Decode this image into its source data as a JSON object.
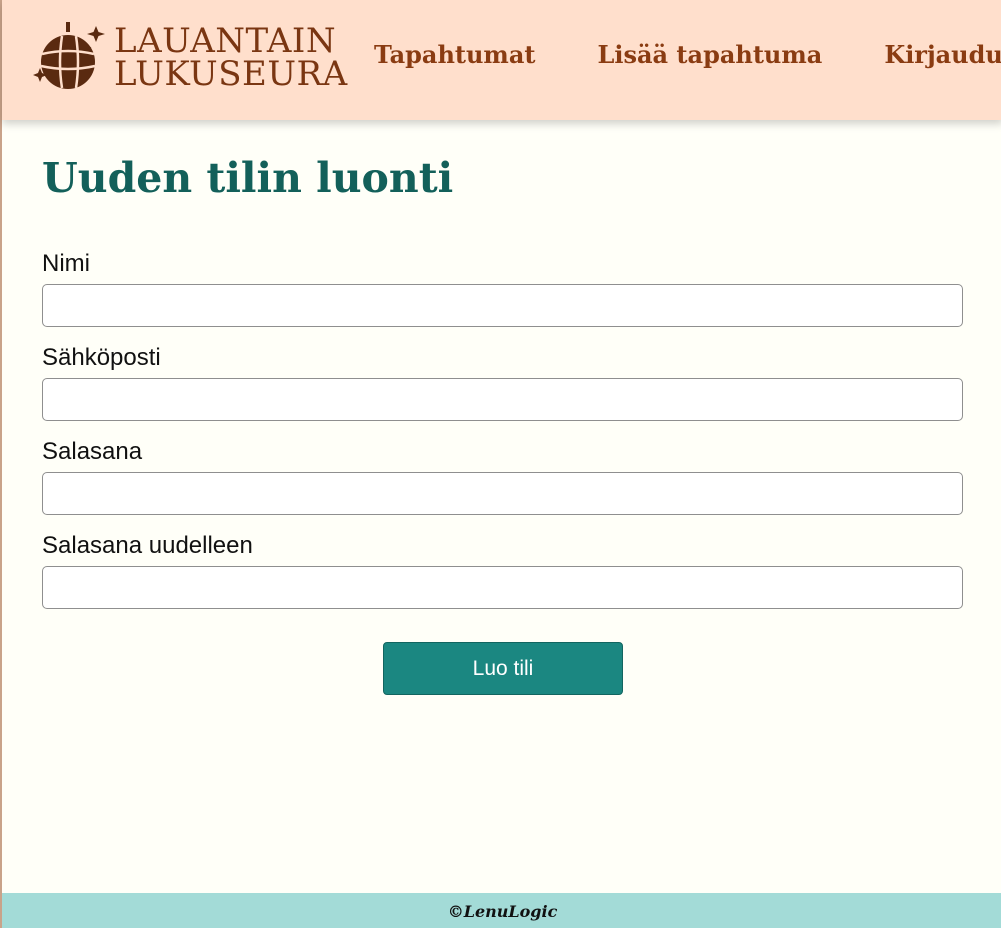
{
  "brand": {
    "line1": "LAUANTAIN",
    "line2": "LUKUSEURA",
    "icon": "disco-ball-sparkles-icon",
    "color": "#7a3612"
  },
  "nav": {
    "items": [
      {
        "label": "Tapahtumat"
      },
      {
        "label": "Lisää tapahtuma"
      },
      {
        "label": "Kirjaudu"
      }
    ]
  },
  "page": {
    "title": "Uuden tilin luonti"
  },
  "form": {
    "fields": [
      {
        "label": "Nimi",
        "value": ""
      },
      {
        "label": "Sähköposti",
        "value": ""
      },
      {
        "label": "Salasana",
        "value": ""
      },
      {
        "label": "Salasana uudelleen",
        "value": ""
      }
    ],
    "submit_label": "Luo tili"
  },
  "footer": {
    "text": "©LenuLogic"
  },
  "colors": {
    "header_bg": "#ffdfcc",
    "page_bg": "#fffff8",
    "title": "#13605a",
    "button": "#1b8781",
    "footer_bg": "#a3dbd7"
  }
}
